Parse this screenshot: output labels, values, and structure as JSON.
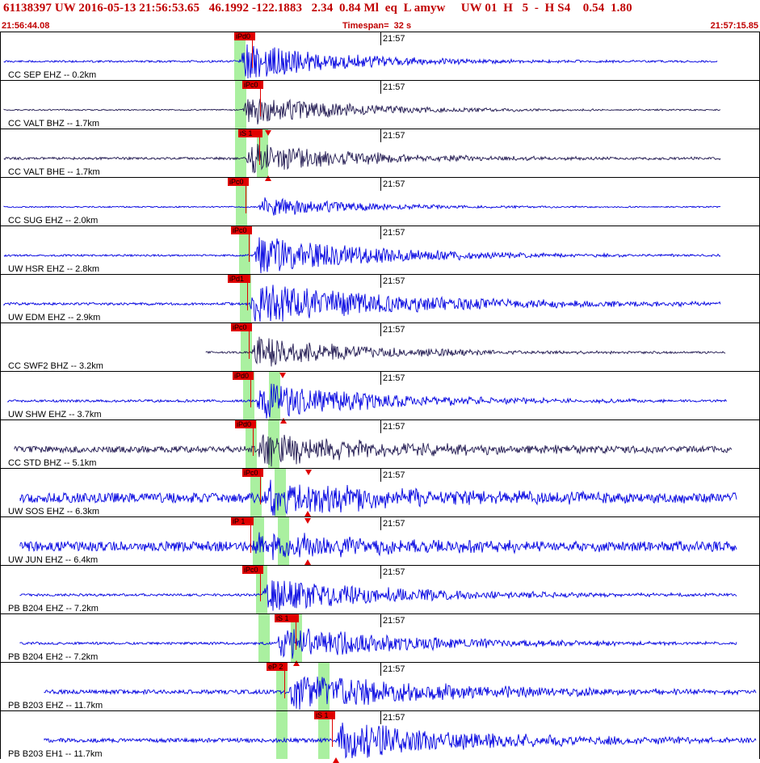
{
  "header": {
    "title_line": "61138397 UW 2016-05-13 21:56:53.65   46.1992 -122.1883   2.34  0.84 Ml  eq  L amyw     UW 01  H   5  -  H S4    0.54  1.80",
    "start_time": "21:56:44.08",
    "timespan": "Timespan=  32 s",
    "end_time": "21:57:15.85"
  },
  "time_tick_label": "21:57",
  "colors": {
    "header_text": "#c00000",
    "pick_flag": "#e00000",
    "pick_window": "#aaf0a0",
    "trace_blue": "#0000e0",
    "trace_dark": "#201850"
  },
  "traces": [
    {
      "label": "CC SEP EHZ -- 0.2km",
      "color": "blue",
      "picks": [
        {
          "text": "iPd0"
        }
      ]
    },
    {
      "label": "CC VALT BHZ -- 1.7km",
      "color": "dark",
      "picks": [
        {
          "text": "iPc0"
        }
      ]
    },
    {
      "label": "CC VALT BHE -- 1.7km",
      "color": "dark",
      "picks": [
        {
          "text": "iS 1"
        }
      ]
    },
    {
      "label": "CC SUG EHZ -- 2.0km",
      "color": "blue",
      "picks": [
        {
          "text": "iPc0"
        }
      ]
    },
    {
      "label": "UW HSR EHZ -- 2.8km",
      "color": "blue",
      "picks": [
        {
          "text": "iPc0"
        }
      ]
    },
    {
      "label": "UW EDM EHZ -- 2.9km",
      "color": "blue",
      "picks": [
        {
          "text": "iPd1"
        }
      ]
    },
    {
      "label": "CC SWF2 BHZ -- 3.2km",
      "color": "dark",
      "picks": [
        {
          "text": "iPc0"
        }
      ]
    },
    {
      "label": "UW SHW EHZ -- 3.7km",
      "color": "blue",
      "picks": [
        {
          "text": "iPd0"
        }
      ]
    },
    {
      "label": "CC STD BHZ -- 5.1km",
      "color": "dark",
      "picks": [
        {
          "text": "iPd0"
        }
      ]
    },
    {
      "label": "UW SOS EHZ -- 6.3km",
      "color": "blue",
      "picks": [
        {
          "text": "iPc0"
        }
      ]
    },
    {
      "label": "UW JUN EHZ -- 6.4km",
      "color": "blue",
      "picks": [
        {
          "text": "iP 1"
        }
      ]
    },
    {
      "label": "PB B204 EHZ -- 7.2km",
      "color": "blue",
      "picks": [
        {
          "text": "iPc0"
        }
      ]
    },
    {
      "label": "PB B204 EH2 -- 7.2km",
      "color": "blue",
      "picks": [
        {
          "text": "iS 1"
        }
      ]
    },
    {
      "label": "PB B203 EHZ -- 11.7km",
      "color": "blue",
      "picks": [
        {
          "text": "eP 2"
        }
      ]
    },
    {
      "label": "PB B203 EH1 -- 11.7km",
      "color": "blue",
      "picks": [
        {
          "text": "iS 1"
        }
      ]
    }
  ]
}
